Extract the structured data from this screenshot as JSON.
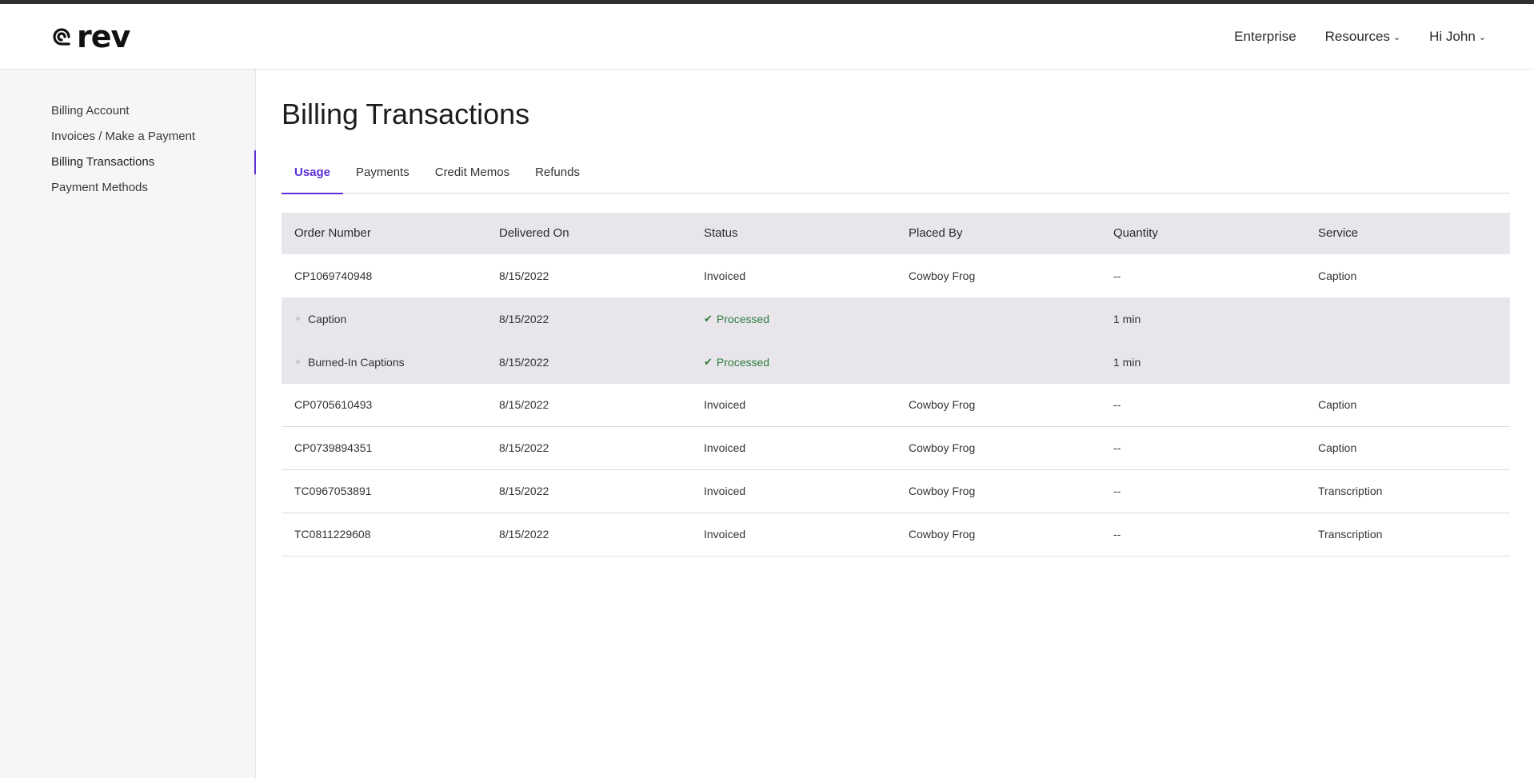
{
  "header": {
    "logo_text": "rev",
    "nav": {
      "enterprise": "Enterprise",
      "resources": "Resources",
      "user": "Hi John"
    }
  },
  "sidebar": {
    "items": [
      {
        "label": "Billing Account"
      },
      {
        "label": "Invoices / Make a Payment"
      },
      {
        "label": "Billing Transactions"
      },
      {
        "label": "Payment Methods"
      }
    ]
  },
  "main": {
    "title": "Billing Transactions",
    "tabs": [
      {
        "label": "Usage"
      },
      {
        "label": "Payments"
      },
      {
        "label": "Credit Memos"
      },
      {
        "label": "Refunds"
      }
    ]
  },
  "table": {
    "headers": [
      "Order Number",
      "Delivered On",
      "Status",
      "Placed By",
      "Quantity",
      "Service"
    ],
    "rows": [
      {
        "order": "CP1069740948",
        "delivered": "8/15/2022",
        "status": "Invoiced",
        "placed_by": "Cowboy Frog",
        "quantity": "--",
        "service": "Caption"
      },
      {
        "order": "CP0705610493",
        "delivered": "8/15/2022",
        "status": "Invoiced",
        "placed_by": "Cowboy Frog",
        "quantity": "--",
        "service": "Caption"
      },
      {
        "order": "CP0739894351",
        "delivered": "8/15/2022",
        "status": "Invoiced",
        "placed_by": "Cowboy Frog",
        "quantity": "--",
        "service": "Caption"
      },
      {
        "order": "TC0967053891",
        "delivered": "8/15/2022",
        "status": "Invoiced",
        "placed_by": "Cowboy Frog",
        "quantity": "--",
        "service": "Transcription"
      },
      {
        "order": "TC0811229608",
        "delivered": "8/15/2022",
        "status": "Invoiced",
        "placed_by": "Cowboy Frog",
        "quantity": "--",
        "service": "Transcription"
      }
    ],
    "subrows": [
      {
        "name": "Caption",
        "delivered": "8/15/2022",
        "status": "Processed",
        "quantity": "1 min"
      },
      {
        "name": "Burned-In Captions",
        "delivered": "8/15/2022",
        "status": "Processed",
        "quantity": "1 min"
      }
    ]
  },
  "colors": {
    "accent": "#5a2fd6",
    "success": "#2e7d3e",
    "header_bg": "#e8e6eb"
  }
}
